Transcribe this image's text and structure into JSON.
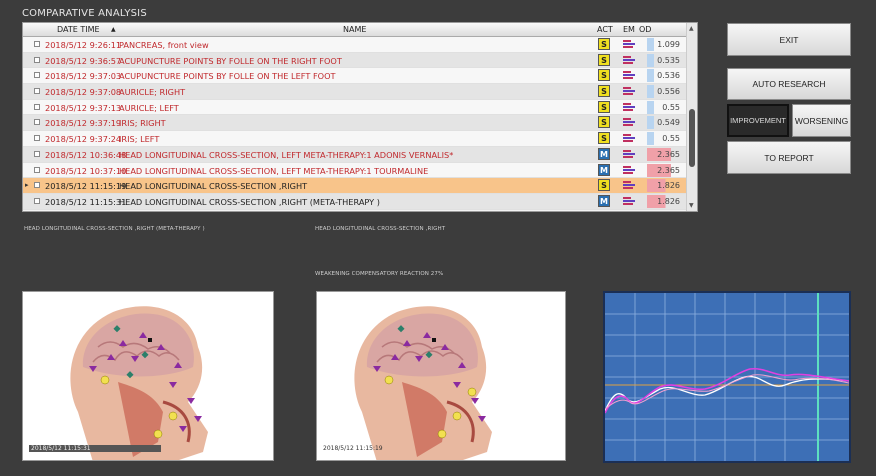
{
  "window": {
    "title": "COMPARATIVE ANALYSIS"
  },
  "table": {
    "columns": {
      "date": "DATE TIME",
      "sort_arrow": "▲",
      "name": "NAME",
      "act": "ACT",
      "em": "EM",
      "od": "OD"
    },
    "rows": [
      {
        "date": "2018/5/12 9:26:11",
        "name": "PANCREAS,  front  view",
        "act": "S",
        "od": "1.099",
        "od_fill": 0.2,
        "od_color": "#b8d4f0",
        "text": "red",
        "style": "plain",
        "marker": ""
      },
      {
        "date": "2018/5/12 9:36:57",
        "name": "ACUPUNCTURE POINTS BY FOLLE ON THE RIGHT FOOT",
        "act": "S",
        "od": "0.535",
        "od_fill": 0.2,
        "od_color": "#b8d4f0",
        "text": "red",
        "style": "alt",
        "marker": ""
      },
      {
        "date": "2018/5/12 9:37:03",
        "name": "ACUPUNCTURE POINTS BY FOLLE ON THE LEFT FOOT",
        "act": "S",
        "od": "0.536",
        "od_fill": 0.2,
        "od_color": "#b8d4f0",
        "text": "red",
        "style": "plain",
        "marker": ""
      },
      {
        "date": "2018/5/12 9:37:08",
        "name": "AURICLE; RIGHT",
        "act": "S",
        "od": "0.556",
        "od_fill": 0.2,
        "od_color": "#b8d4f0",
        "text": "red",
        "style": "alt",
        "marker": ""
      },
      {
        "date": "2018/5/12 9:37:13",
        "name": "AURICLE; LEFT",
        "act": "S",
        "od": "0.55",
        "od_fill": 0.2,
        "od_color": "#b8d4f0",
        "text": "red",
        "style": "plain",
        "marker": ""
      },
      {
        "date": "2018/5/12 9:37:19",
        "name": "IRIS; RIGHT",
        "act": "S",
        "od": "0.549",
        "od_fill": 0.2,
        "od_color": "#b8d4f0",
        "text": "red",
        "style": "alt",
        "marker": ""
      },
      {
        "date": "2018/5/12 9:37:24",
        "name": "IRIS; LEFT",
        "act": "S",
        "od": "0.55",
        "od_fill": 0.2,
        "od_color": "#b8d4f0",
        "text": "red",
        "style": "plain",
        "marker": ""
      },
      {
        "date": "2018/5/12 10:36:48",
        "name": "HEAD LONGITUDINAL CROSS-SECTION, LEFT META-THERAPY:1 ADONIS  VERNALIS*",
        "act": "M",
        "od": "2.365",
        "od_fill": 0.7,
        "od_color": "#f0a0a8",
        "text": "red",
        "style": "alt",
        "marker": ""
      },
      {
        "date": "2018/5/12 10:37:10",
        "name": "HEAD LONGITUDINAL CROSS-SECTION, LEFT META-THERAPY:1 TOURMALINE",
        "act": "M",
        "od": "2.365",
        "od_fill": 0.7,
        "od_color": "#f0a0a8",
        "text": "red",
        "style": "plain",
        "marker": ""
      },
      {
        "date": "2018/5/12 11:15:19",
        "name": "HEAD LONGITUDINAL CROSS-SECTION ,RIGHT",
        "act": "S",
        "od": "1.826",
        "od_fill": 0.55,
        "od_color": "#f0a0a8",
        "text": "dark",
        "style": "sel",
        "marker": "▸"
      },
      {
        "date": "2018/5/12 11:15:31",
        "name": "HEAD LONGITUDINAL CROSS-SECTION ,RIGHT (META-THERAPY )",
        "act": "M",
        "od": "1.826",
        "od_fill": 0.55,
        "od_color": "#f0a0a8",
        "text": "dark",
        "style": "alt",
        "marker": ""
      }
    ]
  },
  "buttons": {
    "exit": "EXIT",
    "auto_research": "AUTO RESEARCH",
    "improvement": "IMPROVEMENT",
    "worsening": "WORSENING",
    "to_report": "TO REPORT"
  },
  "captions": {
    "left": "HEAD LONGITUDINAL CROSS-SECTION ,RIGHT (META-THERAPY )",
    "right": "HEAD LONGITUDINAL CROSS-SECTION ,RIGHT",
    "reaction": "WEAKENING COMPENSATORY REACTION 27%"
  },
  "images": {
    "left_label": "2018/5/12 11:15:31",
    "right_label": "2018/5/12 11:15:19"
  },
  "colors": {
    "background": "#3c3c3c",
    "selected_row": "#f8c48a",
    "chart_bg": "#3d6fb6"
  }
}
